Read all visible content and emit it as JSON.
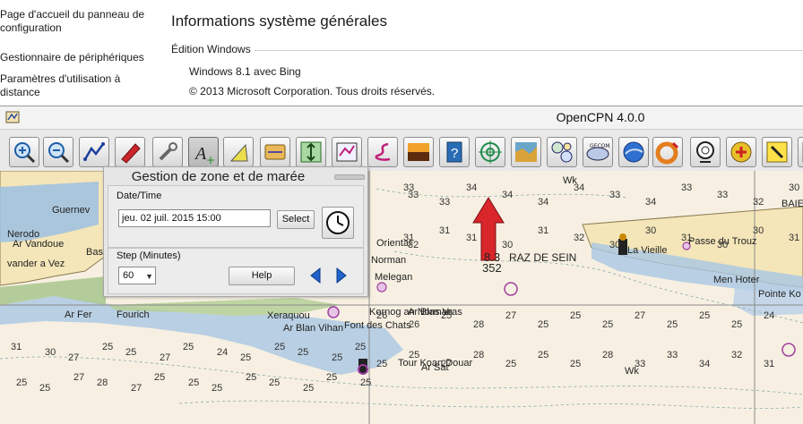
{
  "system": {
    "nav": [
      {
        "line1": "Page d'accueil du panneau de",
        "line2": "configuration"
      },
      {
        "line1": "Gestionnaire de périphériques",
        "line2": ""
      },
      {
        "line1": "Paramètres d'utilisation à",
        "line2": "distance"
      }
    ],
    "title": "Informations système générales",
    "section": "Édition Windows",
    "edition": "Windows 8.1 avec Bing",
    "copyright": "© 2013 Microsoft Corporation. Tous droits réservés."
  },
  "app": {
    "title": "OpenCPN 4.0.0",
    "toolbar": [
      {
        "name": "zoom-in-icon"
      },
      {
        "name": "zoom-out-icon"
      },
      {
        "name": "route-icon"
      },
      {
        "name": "ship-icon"
      },
      {
        "name": "settings-wrench-icon"
      },
      {
        "name": "text-annotation-icon"
      },
      {
        "name": "measure-icon"
      },
      {
        "name": "tide-icon"
      },
      {
        "name": "current-icon"
      },
      {
        "name": "route-manager-icon"
      },
      {
        "name": "track-icon"
      },
      {
        "name": "color-scheme-icon"
      },
      {
        "name": "help-icon"
      },
      {
        "name": "crosshair-icon"
      },
      {
        "name": "grib-weather-icon"
      },
      {
        "name": "dashboard-icon"
      },
      {
        "name": "gecomapi-icon"
      },
      {
        "name": "google-earth-icon"
      },
      {
        "name": "man-overboard-icon"
      },
      {
        "name": "radar-icon"
      },
      {
        "name": "watchdog-icon"
      },
      {
        "name": "waypoint-icon"
      },
      {
        "name": "extra-icon"
      }
    ]
  },
  "tide_dialog": {
    "title": "Gestion de zone et de marée",
    "datetime_label": "Date/Time",
    "datetime_value": "jeu. 02 juil. 2015 15:00",
    "select_label": "Select",
    "step_label": "Step (Minutes)",
    "step_value": "60",
    "help_label": "Help"
  },
  "chart": {
    "labels": [
      {
        "text": "RAZ DE SEIN"
      },
      {
        "text": "8.3"
      },
      {
        "text": "352"
      },
      {
        "text": "Wk"
      },
      {
        "text": "Wk"
      },
      {
        "text": "La Vieille"
      },
      {
        "text": "Passe du Trouz"
      },
      {
        "text": "Men Hoter"
      },
      {
        "text": "Pointe Ko"
      },
      {
        "text": "Kornog an Norman"
      },
      {
        "text": "Ar Blas Vras"
      },
      {
        "text": "Font des Chats"
      },
      {
        "text": "Melegan"
      },
      {
        "text": "Oriental"
      },
      {
        "text": "Norman"
      },
      {
        "text": "Ar Blan Vihan"
      },
      {
        "text": "Tour Koan Douar"
      },
      {
        "text": "Fourich"
      },
      {
        "text": "Xeraquou"
      },
      {
        "text": "Ar Sat"
      },
      {
        "text": "Guernev"
      },
      {
        "text": "Nerodo"
      },
      {
        "text": "Ar Vandoue"
      },
      {
        "text": "vander a Vez"
      },
      {
        "text": "Bass"
      },
      {
        "text": "Ar Fer"
      },
      {
        "text": "BAIE"
      }
    ],
    "soundings": [
      "33",
      "33",
      "33",
      "34",
      "34",
      "34",
      "34",
      "33",
      "34",
      "33",
      "33",
      "32",
      "30",
      "31",
      "32",
      "31",
      "31",
      "30",
      "31",
      "32",
      "30",
      "30",
      "31",
      "30",
      "30",
      "31",
      "31",
      "30",
      "27",
      "25",
      "25",
      "27",
      "25",
      "24",
      "25",
      "25",
      "25",
      "25",
      "25",
      "25",
      "25",
      "27",
      "28",
      "27",
      "25",
      "25",
      "25",
      "25",
      "25",
      "25",
      "25",
      "25",
      "26",
      "26",
      "25",
      "28",
      "27",
      "25",
      "25",
      "25",
      "27",
      "25",
      "25",
      "25",
      "24",
      "25",
      "25",
      "27",
      "28",
      "25",
      "25",
      "25",
      "28",
      "33",
      "33",
      "34",
      "32",
      "31"
    ]
  }
}
